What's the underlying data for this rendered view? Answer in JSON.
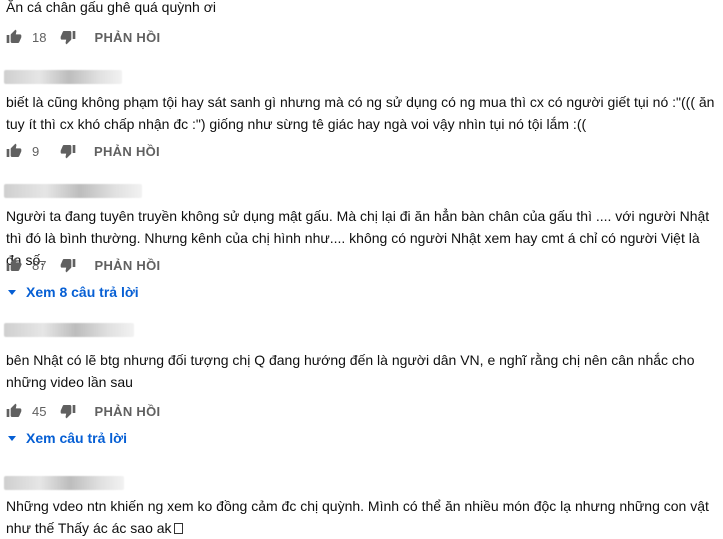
{
  "comments": [
    {
      "text": "Ăn cá chân gấu ghê quá quỳnh ơi",
      "likes": "18",
      "reply_label": "PHẢN HỒI"
    },
    {
      "text": "biết là cũng không phạm tội hay sát sanh gì nhưng mà có ng sử dụng có ng mua thì cx có người giết tụi nó :\"((( ăn tuy ít thì cx khó chấp nhận đc :\") giống như sừng tê giác hay ngà voi vậy nhìn tụi nó tội lắm :((",
      "likes": "9",
      "reply_label": "PHẢN HỒI"
    },
    {
      "text": "Người ta đang tuyên truyền không sử dụng mật gấu. Mà chị lại đi ăn hẳn bàn chân của gấu thì .... với người Nhật thì đó là bình thường. Nhưng kênh của chị hình như.... không có người Nhật xem hay cmt á chỉ có người Việt là đa số.",
      "likes": "87",
      "reply_label": "PHẢN HỒI",
      "view_replies": "Xem 8 câu trả lời"
    },
    {
      "text": "bên Nhật có lẽ btg nhưng đối tượng chị Q đang hướng đến là người dân VN, e nghĩ rằng chị nên cân nhắc cho những video lần sau",
      "likes": "45",
      "reply_label": "PHẢN HỒI",
      "view_replies": "Xem câu trả lời"
    },
    {
      "text": "Những vdeo ntn khiến ng xem ko đồng cảm đc chị quỳnh. Mình có thể ăn nhiều món độc lạ nhưng những con vật như thế Thấy ác ác sao ak"
    }
  ],
  "icons": {
    "like": "thumbs-up-icon",
    "dislike": "thumbs-down-icon",
    "expand": "caret-down-icon"
  },
  "colors": {
    "link": "#065fd4",
    "secondary_text": "#606060",
    "icon": "#606060"
  }
}
